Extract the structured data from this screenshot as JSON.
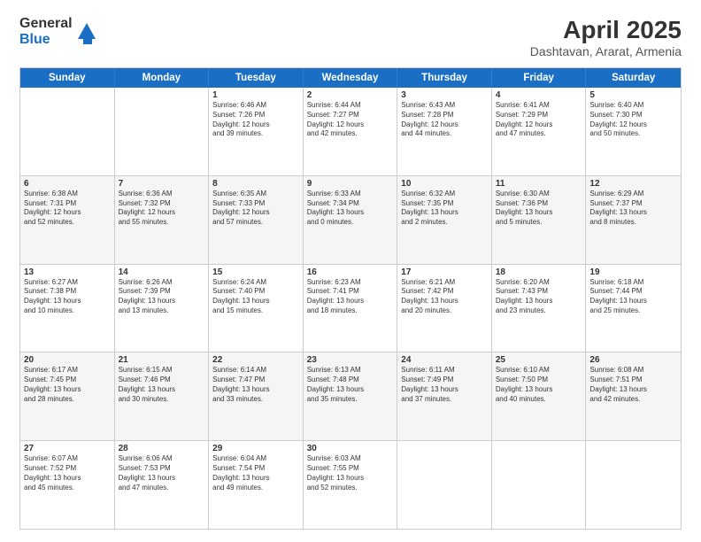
{
  "logo": {
    "general": "General",
    "blue": "Blue"
  },
  "header": {
    "month_year": "April 2025",
    "location": "Dashtavan, Ararat, Armenia"
  },
  "days": [
    "Sunday",
    "Monday",
    "Tuesday",
    "Wednesday",
    "Thursday",
    "Friday",
    "Saturday"
  ],
  "weeks": [
    [
      {
        "day": "",
        "lines": []
      },
      {
        "day": "",
        "lines": []
      },
      {
        "day": "1",
        "lines": [
          "Sunrise: 6:46 AM",
          "Sunset: 7:26 PM",
          "Daylight: 12 hours",
          "and 39 minutes."
        ]
      },
      {
        "day": "2",
        "lines": [
          "Sunrise: 6:44 AM",
          "Sunset: 7:27 PM",
          "Daylight: 12 hours",
          "and 42 minutes."
        ]
      },
      {
        "day": "3",
        "lines": [
          "Sunrise: 6:43 AM",
          "Sunset: 7:28 PM",
          "Daylight: 12 hours",
          "and 44 minutes."
        ]
      },
      {
        "day": "4",
        "lines": [
          "Sunrise: 6:41 AM",
          "Sunset: 7:29 PM",
          "Daylight: 12 hours",
          "and 47 minutes."
        ]
      },
      {
        "day": "5",
        "lines": [
          "Sunrise: 6:40 AM",
          "Sunset: 7:30 PM",
          "Daylight: 12 hours",
          "and 50 minutes."
        ]
      }
    ],
    [
      {
        "day": "6",
        "lines": [
          "Sunrise: 6:38 AM",
          "Sunset: 7:31 PM",
          "Daylight: 12 hours",
          "and 52 minutes."
        ]
      },
      {
        "day": "7",
        "lines": [
          "Sunrise: 6:36 AM",
          "Sunset: 7:32 PM",
          "Daylight: 12 hours",
          "and 55 minutes."
        ]
      },
      {
        "day": "8",
        "lines": [
          "Sunrise: 6:35 AM",
          "Sunset: 7:33 PM",
          "Daylight: 12 hours",
          "and 57 minutes."
        ]
      },
      {
        "day": "9",
        "lines": [
          "Sunrise: 6:33 AM",
          "Sunset: 7:34 PM",
          "Daylight: 13 hours",
          "and 0 minutes."
        ]
      },
      {
        "day": "10",
        "lines": [
          "Sunrise: 6:32 AM",
          "Sunset: 7:35 PM",
          "Daylight: 13 hours",
          "and 2 minutes."
        ]
      },
      {
        "day": "11",
        "lines": [
          "Sunrise: 6:30 AM",
          "Sunset: 7:36 PM",
          "Daylight: 13 hours",
          "and 5 minutes."
        ]
      },
      {
        "day": "12",
        "lines": [
          "Sunrise: 6:29 AM",
          "Sunset: 7:37 PM",
          "Daylight: 13 hours",
          "and 8 minutes."
        ]
      }
    ],
    [
      {
        "day": "13",
        "lines": [
          "Sunrise: 6:27 AM",
          "Sunset: 7:38 PM",
          "Daylight: 13 hours",
          "and 10 minutes."
        ]
      },
      {
        "day": "14",
        "lines": [
          "Sunrise: 6:26 AM",
          "Sunset: 7:39 PM",
          "Daylight: 13 hours",
          "and 13 minutes."
        ]
      },
      {
        "day": "15",
        "lines": [
          "Sunrise: 6:24 AM",
          "Sunset: 7:40 PM",
          "Daylight: 13 hours",
          "and 15 minutes."
        ]
      },
      {
        "day": "16",
        "lines": [
          "Sunrise: 6:23 AM",
          "Sunset: 7:41 PM",
          "Daylight: 13 hours",
          "and 18 minutes."
        ]
      },
      {
        "day": "17",
        "lines": [
          "Sunrise: 6:21 AM",
          "Sunset: 7:42 PM",
          "Daylight: 13 hours",
          "and 20 minutes."
        ]
      },
      {
        "day": "18",
        "lines": [
          "Sunrise: 6:20 AM",
          "Sunset: 7:43 PM",
          "Daylight: 13 hours",
          "and 23 minutes."
        ]
      },
      {
        "day": "19",
        "lines": [
          "Sunrise: 6:18 AM",
          "Sunset: 7:44 PM",
          "Daylight: 13 hours",
          "and 25 minutes."
        ]
      }
    ],
    [
      {
        "day": "20",
        "lines": [
          "Sunrise: 6:17 AM",
          "Sunset: 7:45 PM",
          "Daylight: 13 hours",
          "and 28 minutes."
        ]
      },
      {
        "day": "21",
        "lines": [
          "Sunrise: 6:15 AM",
          "Sunset: 7:46 PM",
          "Daylight: 13 hours",
          "and 30 minutes."
        ]
      },
      {
        "day": "22",
        "lines": [
          "Sunrise: 6:14 AM",
          "Sunset: 7:47 PM",
          "Daylight: 13 hours",
          "and 33 minutes."
        ]
      },
      {
        "day": "23",
        "lines": [
          "Sunrise: 6:13 AM",
          "Sunset: 7:48 PM",
          "Daylight: 13 hours",
          "and 35 minutes."
        ]
      },
      {
        "day": "24",
        "lines": [
          "Sunrise: 6:11 AM",
          "Sunset: 7:49 PM",
          "Daylight: 13 hours",
          "and 37 minutes."
        ]
      },
      {
        "day": "25",
        "lines": [
          "Sunrise: 6:10 AM",
          "Sunset: 7:50 PM",
          "Daylight: 13 hours",
          "and 40 minutes."
        ]
      },
      {
        "day": "26",
        "lines": [
          "Sunrise: 6:08 AM",
          "Sunset: 7:51 PM",
          "Daylight: 13 hours",
          "and 42 minutes."
        ]
      }
    ],
    [
      {
        "day": "27",
        "lines": [
          "Sunrise: 6:07 AM",
          "Sunset: 7:52 PM",
          "Daylight: 13 hours",
          "and 45 minutes."
        ]
      },
      {
        "day": "28",
        "lines": [
          "Sunrise: 6:06 AM",
          "Sunset: 7:53 PM",
          "Daylight: 13 hours",
          "and 47 minutes."
        ]
      },
      {
        "day": "29",
        "lines": [
          "Sunrise: 6:04 AM",
          "Sunset: 7:54 PM",
          "Daylight: 13 hours",
          "and 49 minutes."
        ]
      },
      {
        "day": "30",
        "lines": [
          "Sunrise: 6:03 AM",
          "Sunset: 7:55 PM",
          "Daylight: 13 hours",
          "and 52 minutes."
        ]
      },
      {
        "day": "",
        "lines": []
      },
      {
        "day": "",
        "lines": []
      },
      {
        "day": "",
        "lines": []
      }
    ]
  ]
}
